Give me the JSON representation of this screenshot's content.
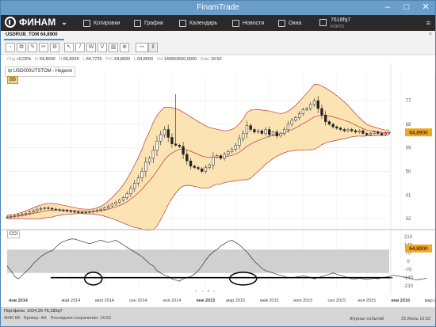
{
  "window": {
    "title": "FinamTrade"
  },
  "toolbar": {
    "logo_text": "ФИНАМ",
    "items": [
      "Котировки",
      "График",
      "Календарь",
      "Новости",
      "Окна"
    ],
    "account": {
      "id": "7618fq7",
      "subtitle": "FORTS"
    }
  },
  "chart_tab": {
    "label": "USDRUB_TOM 64,8900",
    "close": "×"
  },
  "stats": {
    "chg_label": "Chg",
    "chg": "+0,02%",
    "o_label": "O",
    "open": "64,8000",
    "h_label": "H",
    "high": "65,8325",
    "l_label": "L",
    "low": "64,7725",
    "prc_label": "PrC",
    "prev_close": "64,8000",
    "last_label": "L",
    "last": "64,8900",
    "vol_label": "Vol",
    "volume": "140563600,0000",
    "date_label": "Date",
    "date": "16:52"
  },
  "legend": {
    "instrument": "USD000UTSTOM - Неделя",
    "bb": "BB",
    "cci": "CCI"
  },
  "colors": {
    "candle": "#222222",
    "band_fill": "#fbe3b4",
    "band_line": "#c0392b",
    "price_badge": "#f5a623",
    "cci_zone": "#d0d0d0",
    "annotation": "#000000"
  },
  "chart_data": [
    {
      "type": "candlestick",
      "instrument": "USD000UTSTOM",
      "timeframe": "Неделя",
      "indicator": "BB",
      "y_ticks": [
        32,
        41,
        50,
        59,
        68,
        77
      ],
      "ylim": [
        29,
        87
      ],
      "last_value": "64,8900",
      "x_ticks": [
        "янв 2014",
        "май 2014",
        "июл 2014",
        "сен 2014",
        "ноя 2014",
        "янв 2015",
        "мар 2015",
        "май 2015",
        "июл 2015",
        "сен 2015",
        "ноя 2015",
        "янв 2016",
        "мар 2016",
        "май 2016",
        "июл 2016"
      ],
      "x_ticks_bold": [
        "янв 2014",
        "янв 2015",
        "янв 2016"
      ],
      "x_tick_index": [
        0,
        17,
        26,
        35,
        44,
        53,
        61,
        70,
        79,
        88,
        96,
        105,
        114,
        122,
        130
      ],
      "close": [
        32.6,
        32.8,
        33.0,
        33.3,
        33.6,
        34.0,
        34.5,
        35.0,
        35.6,
        35.9,
        36.1,
        35.9,
        35.6,
        35.4,
        35.2,
        35.1,
        34.9,
        34.7,
        34.5,
        34.4,
        34.3,
        34.4,
        34.6,
        34.9,
        35.2,
        35.6,
        36.1,
        36.8,
        37.5,
        38.2,
        39.0,
        40.0,
        41.5,
        43.5,
        45.5,
        47.5,
        50.0,
        53.5,
        55.0,
        58.0,
        61.5,
        64.0,
        66.0,
        63.0,
        60.5,
        60.0,
        59.5,
        56.5,
        54.0,
        52.0,
        51.5,
        51.0,
        50.0,
        51.5,
        52.5,
        55.5,
        56.0,
        55.0,
        56.5,
        57.5,
        58.5,
        60.0,
        62.5,
        64.5,
        67.5,
        66.0,
        65.0,
        65.5,
        64.5,
        66.0,
        64.0,
        65.0,
        63.5,
        64.5,
        66.0,
        68.0,
        69.5,
        70.5,
        72.0,
        73.5,
        74.0,
        75.5,
        77.0,
        74.0,
        71.5,
        69.0,
        68.0,
        67.0,
        66.5,
        66.0,
        65.5,
        66.0,
        65.5,
        65.0,
        65.5,
        64.5,
        64.0,
        64.5,
        65.0,
        64.5,
        64.0,
        64.6,
        64.89
      ],
      "bb_middle": [
        32.6,
        32.7,
        32.8,
        33.0,
        33.2,
        33.4,
        33.7,
        34.0,
        34.3,
        34.6,
        34.9,
        35.1,
        35.2,
        35.3,
        35.3,
        35.3,
        35.2,
        35.1,
        35.0,
        34.9,
        34.8,
        34.7,
        34.7,
        34.7,
        34.8,
        35.0,
        35.2,
        35.6,
        36.0,
        36.5,
        37.0,
        37.6,
        38.4,
        39.4,
        40.5,
        41.8,
        43.2,
        44.9,
        46.4,
        48.2,
        50.2,
        52.3,
        54.4,
        55.9,
        57.0,
        57.8,
        58.4,
        58.5,
        58.2,
        57.7,
        57.1,
        56.5,
        55.9,
        55.5,
        55.3,
        55.5,
        55.6,
        55.5,
        55.6,
        55.8,
        56.1,
        56.6,
        57.4,
        58.4,
        59.6,
        60.4,
        61.1,
        61.8,
        62.3,
        63.0,
        63.4,
        63.8,
        64.0,
        64.3,
        64.7,
        65.3,
        65.9,
        66.6,
        67.4,
        68.2,
        69.0,
        69.9,
        70.8,
        71.2,
        71.4,
        71.3,
        71.1,
        70.8,
        70.4,
        70.0,
        69.5,
        69.0,
        68.4,
        67.7,
        67.0,
        66.3,
        65.8,
        65.5,
        65.3,
        65.1,
        64.9,
        64.8,
        64.9
      ],
      "bb_upper": [
        33.2,
        33.4,
        33.6,
        34.0,
        34.4,
        34.9,
        35.5,
        36.1,
        36.7,
        37.2,
        37.6,
        37.8,
        37.8,
        37.6,
        37.4,
        37.1,
        36.8,
        36.5,
        36.2,
        35.9,
        35.7,
        35.6,
        35.6,
        35.7,
        36.1,
        36.7,
        37.5,
        38.7,
        40.0,
        41.5,
        43.1,
        44.9,
        47.1,
        49.7,
        52.4,
        55.2,
        58.4,
        62.2,
        65.2,
        68.7,
        71.3,
        73.0,
        74.5,
        74.5,
        74.3,
        73.9,
        73.4,
        72.6,
        71.7,
        70.8,
        69.9,
        69.0,
        68.2,
        67.4,
        66.8,
        66.4,
        66.1,
        65.8,
        65.5,
        65.6,
        66.0,
        66.8,
        68.2,
        70.0,
        72.4,
        73.4,
        73.5,
        73.6,
        73.4,
        73.3,
        73.0,
        72.7,
        72.3,
        72.1,
        72.3,
        73.0,
        74.0,
        75.2,
        76.7,
        78.3,
        79.8,
        81.5,
        83.2,
        83.2,
        82.6,
        81.8,
        80.9,
        80.0,
        78.9,
        77.8,
        76.5,
        75.2,
        73.6,
        72.0,
        70.5,
        69.2,
        68.0,
        67.4,
        66.9,
        66.5,
        66.1,
        65.8,
        65.8
      ],
      "bb_lower": [
        32.0,
        32.0,
        32.0,
        32.0,
        32.0,
        31.9,
        31.9,
        31.9,
        31.9,
        32.0,
        32.2,
        32.4,
        32.6,
        33.0,
        33.2,
        33.5,
        33.6,
        33.7,
        33.8,
        33.9,
        33.9,
        33.8,
        33.8,
        33.7,
        33.5,
        33.3,
        32.9,
        32.5,
        32.0,
        31.5,
        30.9,
        30.3,
        29.7,
        29.1,
        28.6,
        28.4,
        28.0,
        27.6,
        27.6,
        27.7,
        29.1,
        31.6,
        34.3,
        37.3,
        39.7,
        41.7,
        43.4,
        44.4,
        44.7,
        44.6,
        44.3,
        44.0,
        43.6,
        43.6,
        43.8,
        44.6,
        45.1,
        45.2,
        45.7,
        46.0,
        46.2,
        46.4,
        46.6,
        46.8,
        46.8,
        47.4,
        48.7,
        50.0,
        51.2,
        52.7,
        53.8,
        54.9,
        55.7,
        56.5,
        57.1,
        57.6,
        57.8,
        58.0,
        58.1,
        58.1,
        58.2,
        58.3,
        58.4,
        59.2,
        60.2,
        60.8,
        61.3,
        61.6,
        61.9,
        62.2,
        62.5,
        62.8,
        63.2,
        63.4,
        63.5,
        63.4,
        63.6,
        63.6,
        63.7,
        63.7,
        63.7,
        63.8,
        64.0
      ],
      "spike_index": 45,
      "spike_high": 79.5
    },
    {
      "type": "line",
      "indicator": "CCI",
      "y_ticks": [
        210,
        140,
        70,
        0,
        -70,
        -140,
        -210
      ],
      "ylim": [
        -230,
        230
      ],
      "last_value": "64,8900",
      "shaded_band": [
        -100,
        100
      ],
      "annotation_line_value": -140,
      "highlight_index": [
        23,
        63,
        126
      ],
      "values": [
        -40,
        -80,
        -130,
        -150,
        -120,
        -90,
        -60,
        -20,
        10,
        40,
        60,
        80,
        90,
        120,
        150,
        170,
        180,
        190,
        190,
        180,
        170,
        160,
        150,
        160,
        170,
        180,
        170,
        160,
        170,
        180,
        160,
        140,
        120,
        100,
        80,
        60,
        40,
        10,
        -20,
        -40,
        -80,
        -100,
        -120,
        -130,
        -150,
        -160,
        -170,
        -150,
        -140,
        -130,
        -110,
        -80,
        -40,
        10,
        50,
        80,
        100,
        130,
        150,
        170,
        180,
        160,
        140,
        110,
        80,
        40,
        0,
        -30,
        -60,
        -80,
        -90,
        -100,
        -110,
        -120,
        -130,
        -140,
        -140,
        -135,
        -130,
        -125,
        -130,
        -140,
        -150,
        -140,
        -130,
        -120,
        -110,
        -100,
        -110,
        -120,
        -130,
        -140,
        -150,
        -150,
        -145,
        -150,
        -155,
        -150,
        -145,
        -150,
        -140,
        -135,
        -130,
        -120,
        -125,
        -130,
        -135,
        -140,
        -150,
        -160,
        -155,
        -150,
        -145
      ]
    }
  ],
  "status": {
    "line1": "Портфель: 1024,26-76,185q7",
    "kb": "4040 КБ",
    "server": "Брокер: AK",
    "last_save": "Последнее сохранение: 16:52",
    "journal": "Журнал событий",
    "datetime": "25 Июль 16:52"
  }
}
